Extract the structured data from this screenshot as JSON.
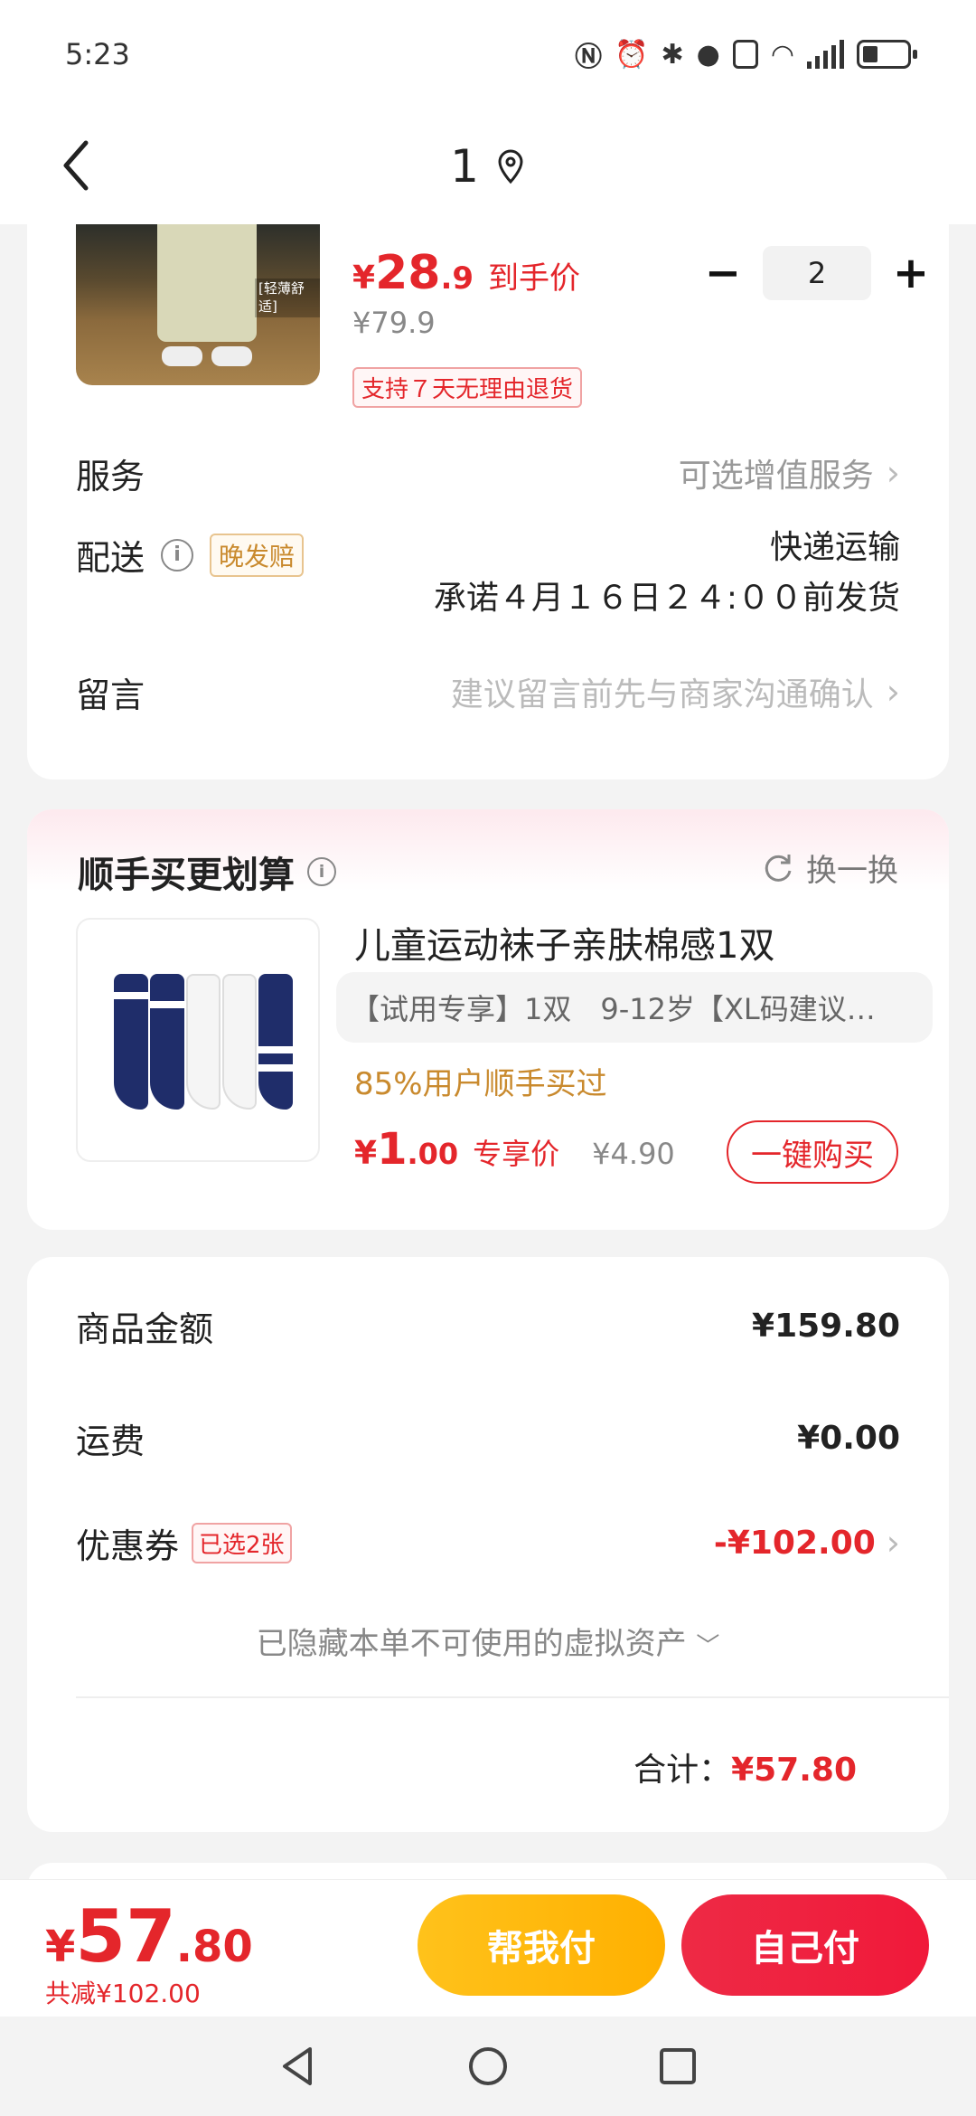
{
  "status_bar": {
    "time": "5:23"
  },
  "nav": {
    "title": "1"
  },
  "product": {
    "price_currency": "¥",
    "price_int": "28",
    "price_dec": ".9",
    "price_tag": "到手价",
    "original_price": "¥79.9",
    "return_badge": "支持７天无理由退货",
    "quantity": "2",
    "thumb_tag": "[轻薄舒适]"
  },
  "service": {
    "label": "服务",
    "value": "可选增值服务"
  },
  "delivery": {
    "label": "配送",
    "badge": "晚发赔",
    "method": "快递运输",
    "promise": "承诺４月１６日２４:００前发货"
  },
  "message": {
    "label": "留言",
    "placeholder": "建议留言前先与商家沟通确认"
  },
  "addon": {
    "title": "顺手买更划算",
    "swap_label": "换一换",
    "name": "儿童运动袜子亲肤棉感1双",
    "spec": "【试用专享】1双　9-12岁【XL码建议…",
    "popularity": "85%用户顺手买过",
    "price_currency": "¥",
    "price_int": "1",
    "price_dec": ".00",
    "price_tag": "专享价",
    "original_price": "¥4.90",
    "buy_label": "一键购买"
  },
  "summary": {
    "goods_label": "商品金额",
    "goods_value": "¥159.80",
    "shipping_label": "运费",
    "shipping_value": "¥0.00",
    "coupon_label": "优惠券",
    "coupon_badge": "已选2张",
    "coupon_value": "-¥102.00",
    "hidden_note": "已隐藏本单不可使用的虚拟资产",
    "total_label": "合计：",
    "total_value": "¥57.80"
  },
  "bottom": {
    "currency": "¥",
    "price_int": "57",
    "price_dec": ".80",
    "saved": "共减¥102.00",
    "help_pay": "帮我付",
    "self_pay": "自己付"
  },
  "colors": {
    "accent": "#e4262b",
    "gold": "#ffb000"
  }
}
